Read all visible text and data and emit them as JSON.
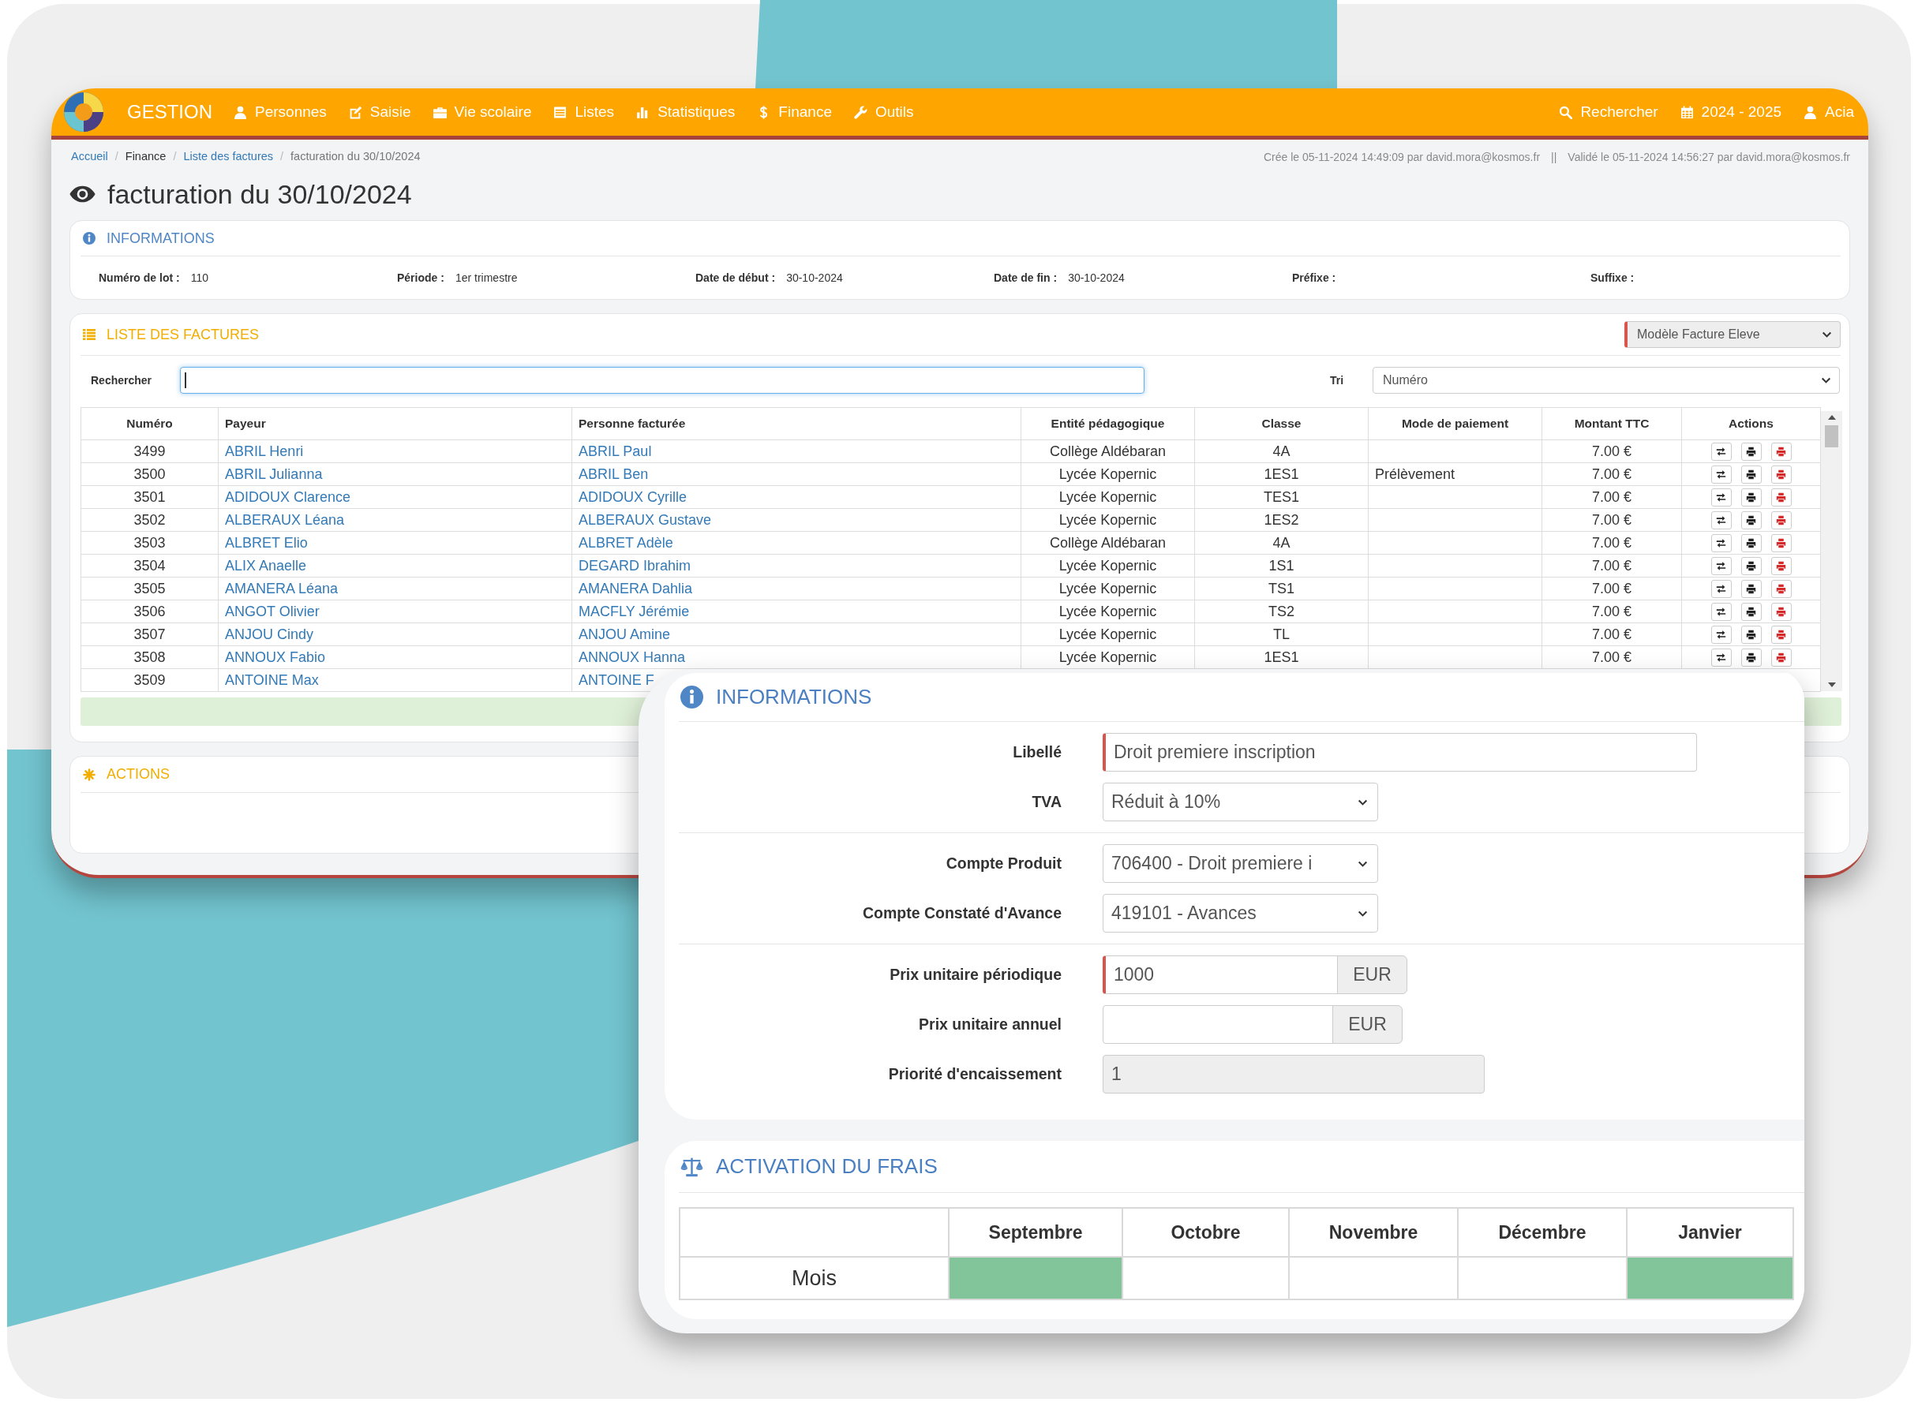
{
  "navbar": {
    "brand": "GESTION",
    "menu": [
      "Personnes",
      "Saisie",
      "Vie scolaire",
      "Listes",
      "Statistiques",
      "Finance",
      "Outils"
    ],
    "tools": [
      "Rechercher",
      "2024 - 2025",
      "Acia"
    ]
  },
  "breadcrumb": [
    {
      "kind": "link",
      "label": "Accueil"
    },
    {
      "kind": "separator",
      "label": "/"
    },
    {
      "kind": "plain",
      "label": "Finance"
    },
    {
      "kind": "separator",
      "label": "/"
    },
    {
      "kind": "link",
      "label": "Liste des factures"
    },
    {
      "kind": "separator",
      "label": "/"
    },
    {
      "kind": "current",
      "label": "facturation du 30/10/2024"
    }
  ],
  "audit": {
    "created": "Crée le 05-11-2024 14:49:09 par david.mora@kosmos.fr",
    "separator": "||",
    "validated": "Validé le 05-11-2024 14:56:27 par david.mora@kosmos.fr"
  },
  "page_title": "facturation du 30/10/2024",
  "info_panel": {
    "title": "INFORMATIONS",
    "fields": [
      {
        "label": "Numéro de lot :",
        "value": "110"
      },
      {
        "label": "Période :",
        "value": "1er trimestre"
      },
      {
        "label": "Date de début :",
        "value": "30-10-2024"
      },
      {
        "label": "Date de fin :",
        "value": "30-10-2024"
      },
      {
        "label": "Préfixe :"
      },
      {
        "label": "Suffixe :"
      }
    ]
  },
  "invoices_panel": {
    "title": "LISTE DES FACTURES",
    "template_select": {
      "value": "Modèle Facture Eleve",
      "required": true
    },
    "search": {
      "label": "Rechercher",
      "focused": true
    },
    "sort": {
      "label": "Tri",
      "value": "Numéro",
      "required": false
    },
    "table": {
      "columns": [
        "Numéro",
        "Payeur",
        "Personne facturée",
        "Entité pédagogique",
        "Classe",
        "Mode de paiement",
        "Montant TTC",
        "Actions"
      ],
      "rows": [
        {
          "numero": "3499",
          "payeur": "ABRIL Henri",
          "personne_facturee": "ABRIL Paul",
          "entite_pedagogique": "Collège Aldébaran",
          "classe": "4A",
          "montant_ttc": "7.00 €"
        },
        {
          "numero": "3500",
          "payeur": "ABRIL Julianna",
          "personne_facturee": "ABRIL Ben",
          "entite_pedagogique": "Lycée Kopernic",
          "classe": "1ES1",
          "mode_de_paiement": "Prélèvement",
          "montant_ttc": "7.00 €"
        },
        {
          "numero": "3501",
          "payeur": "ADIDOUX Clarence",
          "personne_facturee": "ADIDOUX Cyrille",
          "entite_pedagogique": "Lycée Kopernic",
          "classe": "TES1",
          "montant_ttc": "7.00 €"
        },
        {
          "numero": "3502",
          "payeur": "ALBERAUX Léana",
          "personne_facturee": "ALBERAUX Gustave",
          "entite_pedagogique": "Lycée Kopernic",
          "classe": "1ES2",
          "montant_ttc": "7.00 €"
        },
        {
          "numero": "3503",
          "payeur": "ALBRET Elio",
          "personne_facturee": "ALBRET Adèle",
          "entite_pedagogique": "Collège Aldébaran",
          "classe": "4A",
          "montant_ttc": "7.00 €"
        },
        {
          "numero": "3504",
          "payeur": "ALIX Anaelle",
          "personne_facturee": "DEGARD Ibrahim",
          "entite_pedagogique": "Lycée Kopernic",
          "classe": "1S1",
          "montant_ttc": "7.00 €"
        },
        {
          "numero": "3505",
          "payeur": "AMANERA Léana",
          "personne_facturee": "AMANERA Dahlia",
          "entite_pedagogique": "Lycée Kopernic",
          "classe": "TS1",
          "montant_ttc": "7.00 €"
        },
        {
          "numero": "3506",
          "payeur": "ANGOT Olivier",
          "personne_facturee": "MACFLY Jérémie",
          "entite_pedagogique": "Lycée Kopernic",
          "classe": "TS2",
          "montant_ttc": "7.00 €"
        },
        {
          "numero": "3507",
          "payeur": "ANJOU Cindy",
          "personne_facturee": "ANJOU Amine",
          "entite_pedagogique": "Lycée Kopernic",
          "classe": "TL",
          "montant_ttc": "7.00 €"
        },
        {
          "numero": "3508",
          "payeur": "ANNOUX Fabio",
          "personne_facturee": "ANNOUX Hanna",
          "entite_pedagogique": "Lycée Kopernic",
          "classe": "1ES1",
          "montant_ttc": "7.00 €"
        },
        {
          "numero": "3509",
          "payeur": "ANTOINE Max",
          "personne_facturee": "ANTOINE F"
        }
      ]
    }
  },
  "actions_panel": {
    "title": "ACTIONS"
  },
  "fee_form": {
    "info": {
      "title": "INFORMATIONS",
      "groups": [
        [
          {
            "kind": "text",
            "label": "Libellé",
            "value": "Droit premiere inscription",
            "required": true,
            "disabled": false
          },
          {
            "kind": "select",
            "label": "TVA",
            "value": "Réduit à 10%",
            "required": false,
            "disabled": false
          }
        ],
        [
          {
            "kind": "select",
            "label": "Compte Produit",
            "value": "706400 - Droit premiere i",
            "required": false,
            "disabled": false
          },
          {
            "kind": "select",
            "label": "Compte Constaté d'Avance",
            "value": "419101 - Avances",
            "required": false,
            "disabled": false
          }
        ],
        [
          {
            "kind": "currency",
            "label": "Prix unitaire périodique",
            "value": "1000",
            "addon": "EUR",
            "required": true,
            "disabled": false
          },
          {
            "kind": "currency",
            "label": "Prix unitaire annuel",
            "addon": "EUR",
            "required": false,
            "disabled": false
          },
          {
            "kind": "text",
            "label": "Priorité d'encaissement",
            "value": "1",
            "required": false,
            "disabled": true
          }
        ]
      ]
    },
    "activation": {
      "title": "ACTIVATION DU FRAIS",
      "row_label": "Mois",
      "months": [
        {
          "label": "Septembre",
          "active": true
        },
        {
          "label": "Octobre",
          "active": false
        },
        {
          "label": "Novembre",
          "active": false
        },
        {
          "label": "Décembre",
          "active": false
        },
        {
          "label": "Janvier",
          "active": true
        }
      ]
    }
  }
}
